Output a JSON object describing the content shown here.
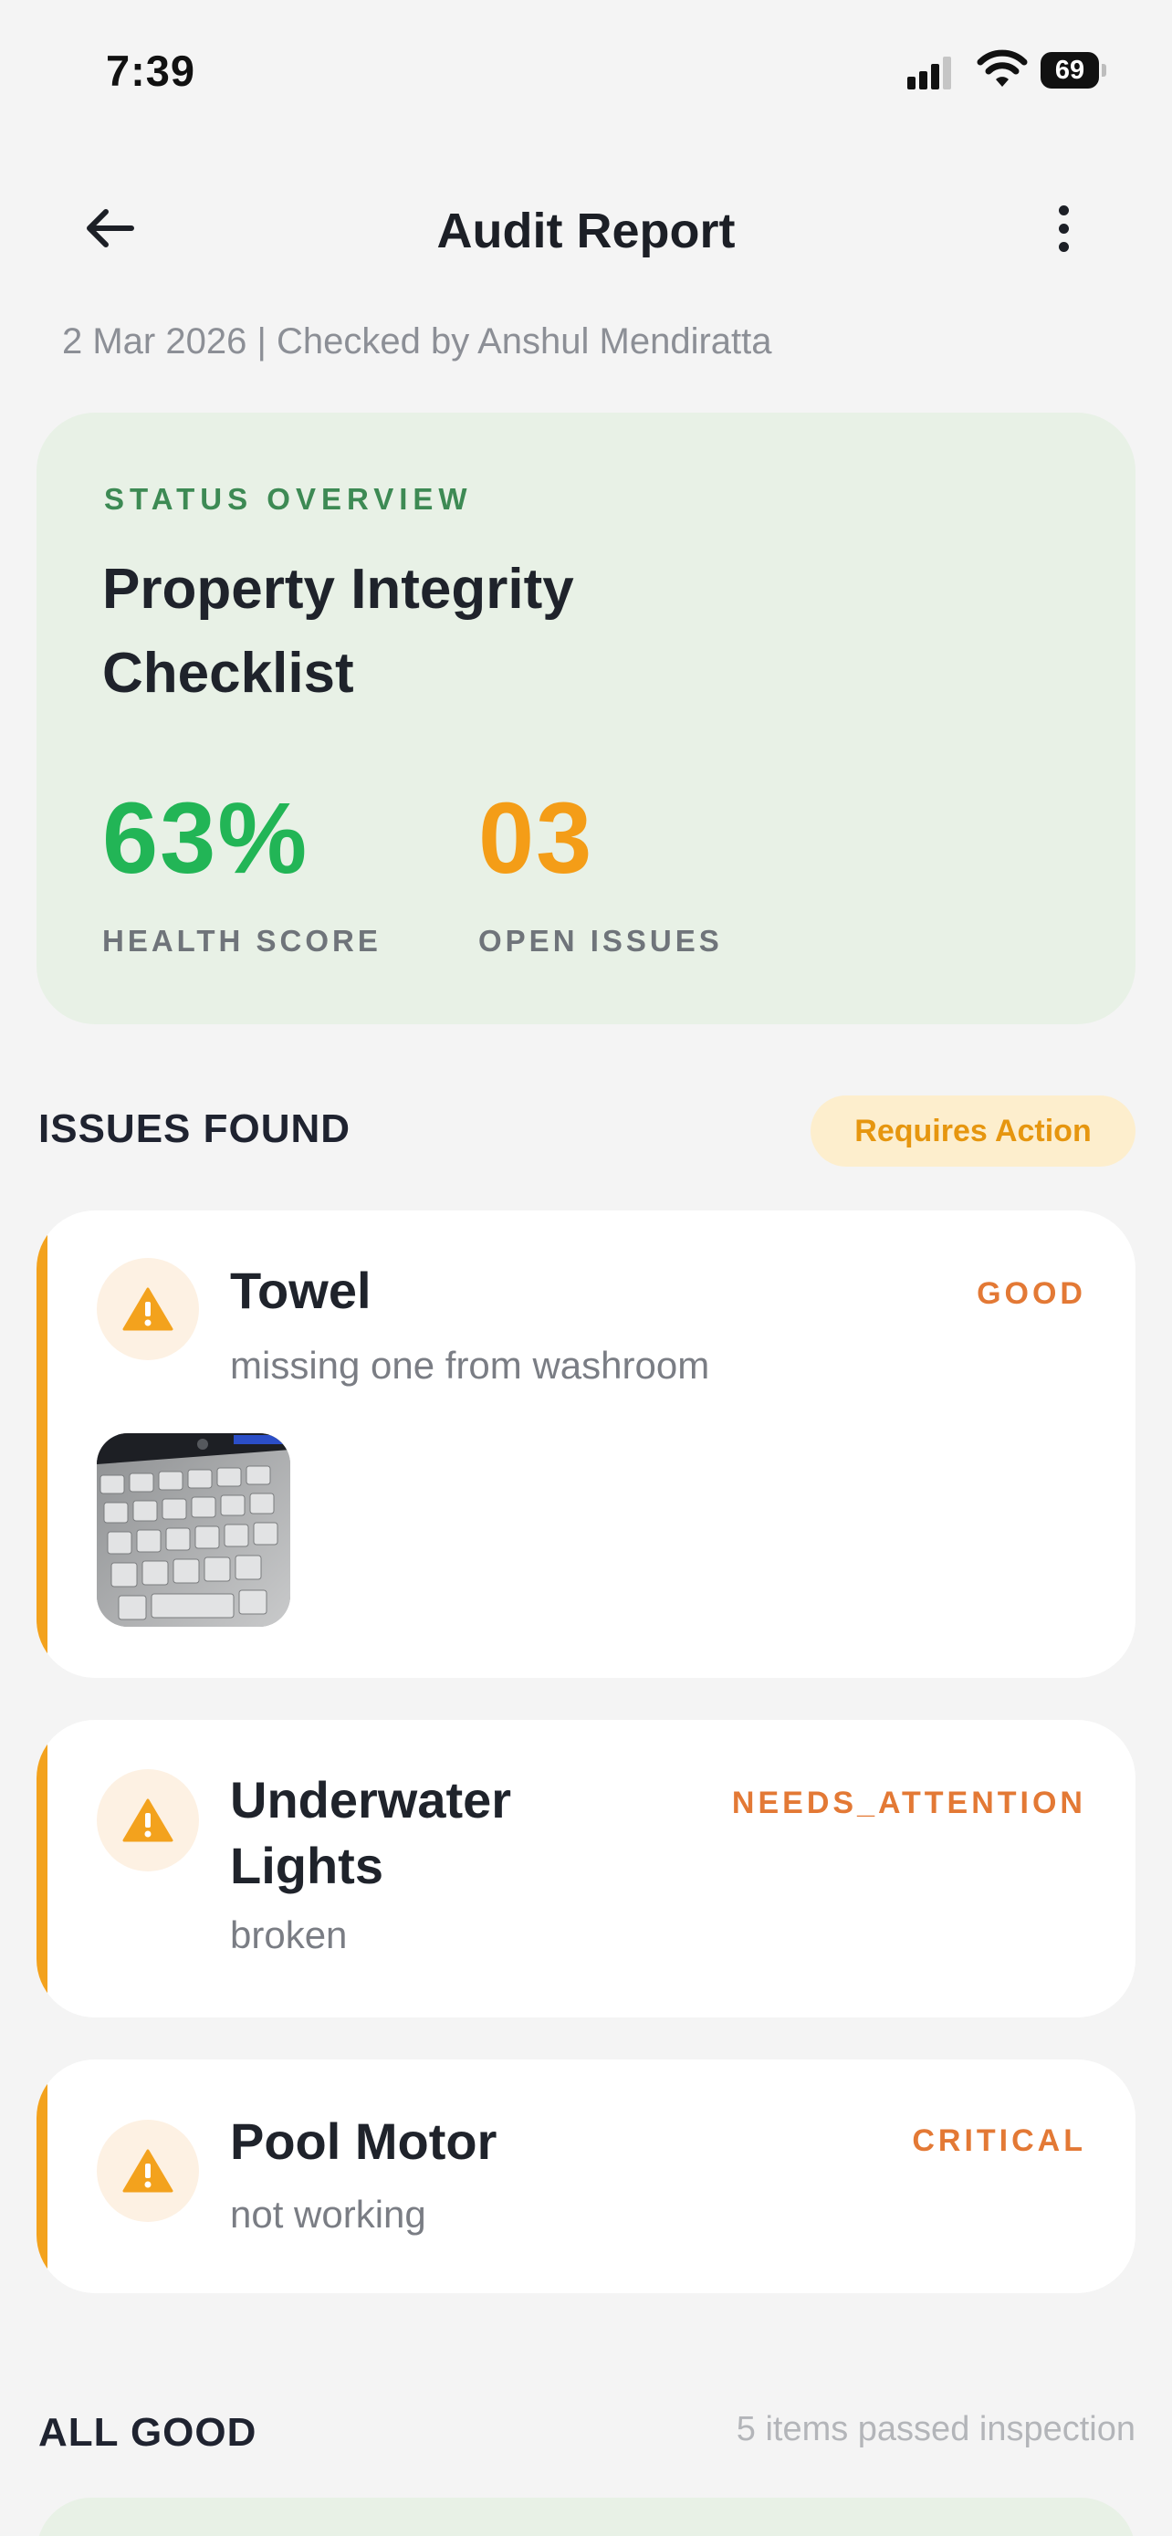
{
  "status_bar": {
    "time": "7:39",
    "battery": "69"
  },
  "header": {
    "title": "Audit Report",
    "back_icon": "arrow-left-icon",
    "menu_icon": "more-vertical-icon"
  },
  "subtitle": "2 Mar 2026 | Checked by Anshul Mendiratta",
  "overview": {
    "label": "STATUS OVERVIEW",
    "title": "Property Integrity Checklist",
    "health_score": "63%",
    "health_label": "HEALTH SCORE",
    "open_issues": "03",
    "open_label": "OPEN ISSUES"
  },
  "issues_section": {
    "title": "ISSUES FOUND",
    "badge": "Requires Action",
    "items": [
      {
        "name": "Towel",
        "description": "missing one from washroom",
        "severity": "GOOD",
        "icon": "warning-icon",
        "has_photo": true
      },
      {
        "name": "Underwater\nLights",
        "description": "broken",
        "severity": "NEEDS_ATTENTION",
        "icon": "warning-icon"
      },
      {
        "name": "Pool Motor",
        "description": "not working",
        "severity": "CRITICAL",
        "icon": "warning-icon"
      }
    ]
  },
  "good_section": {
    "title": "ALL GOOD",
    "summary": "5 items passed inspection"
  },
  "colors": {
    "accent_orange": "#f3a21d",
    "health_green": "#22b556",
    "severity_orange": "#e37935",
    "overview_bg": "#e8f1e6"
  }
}
